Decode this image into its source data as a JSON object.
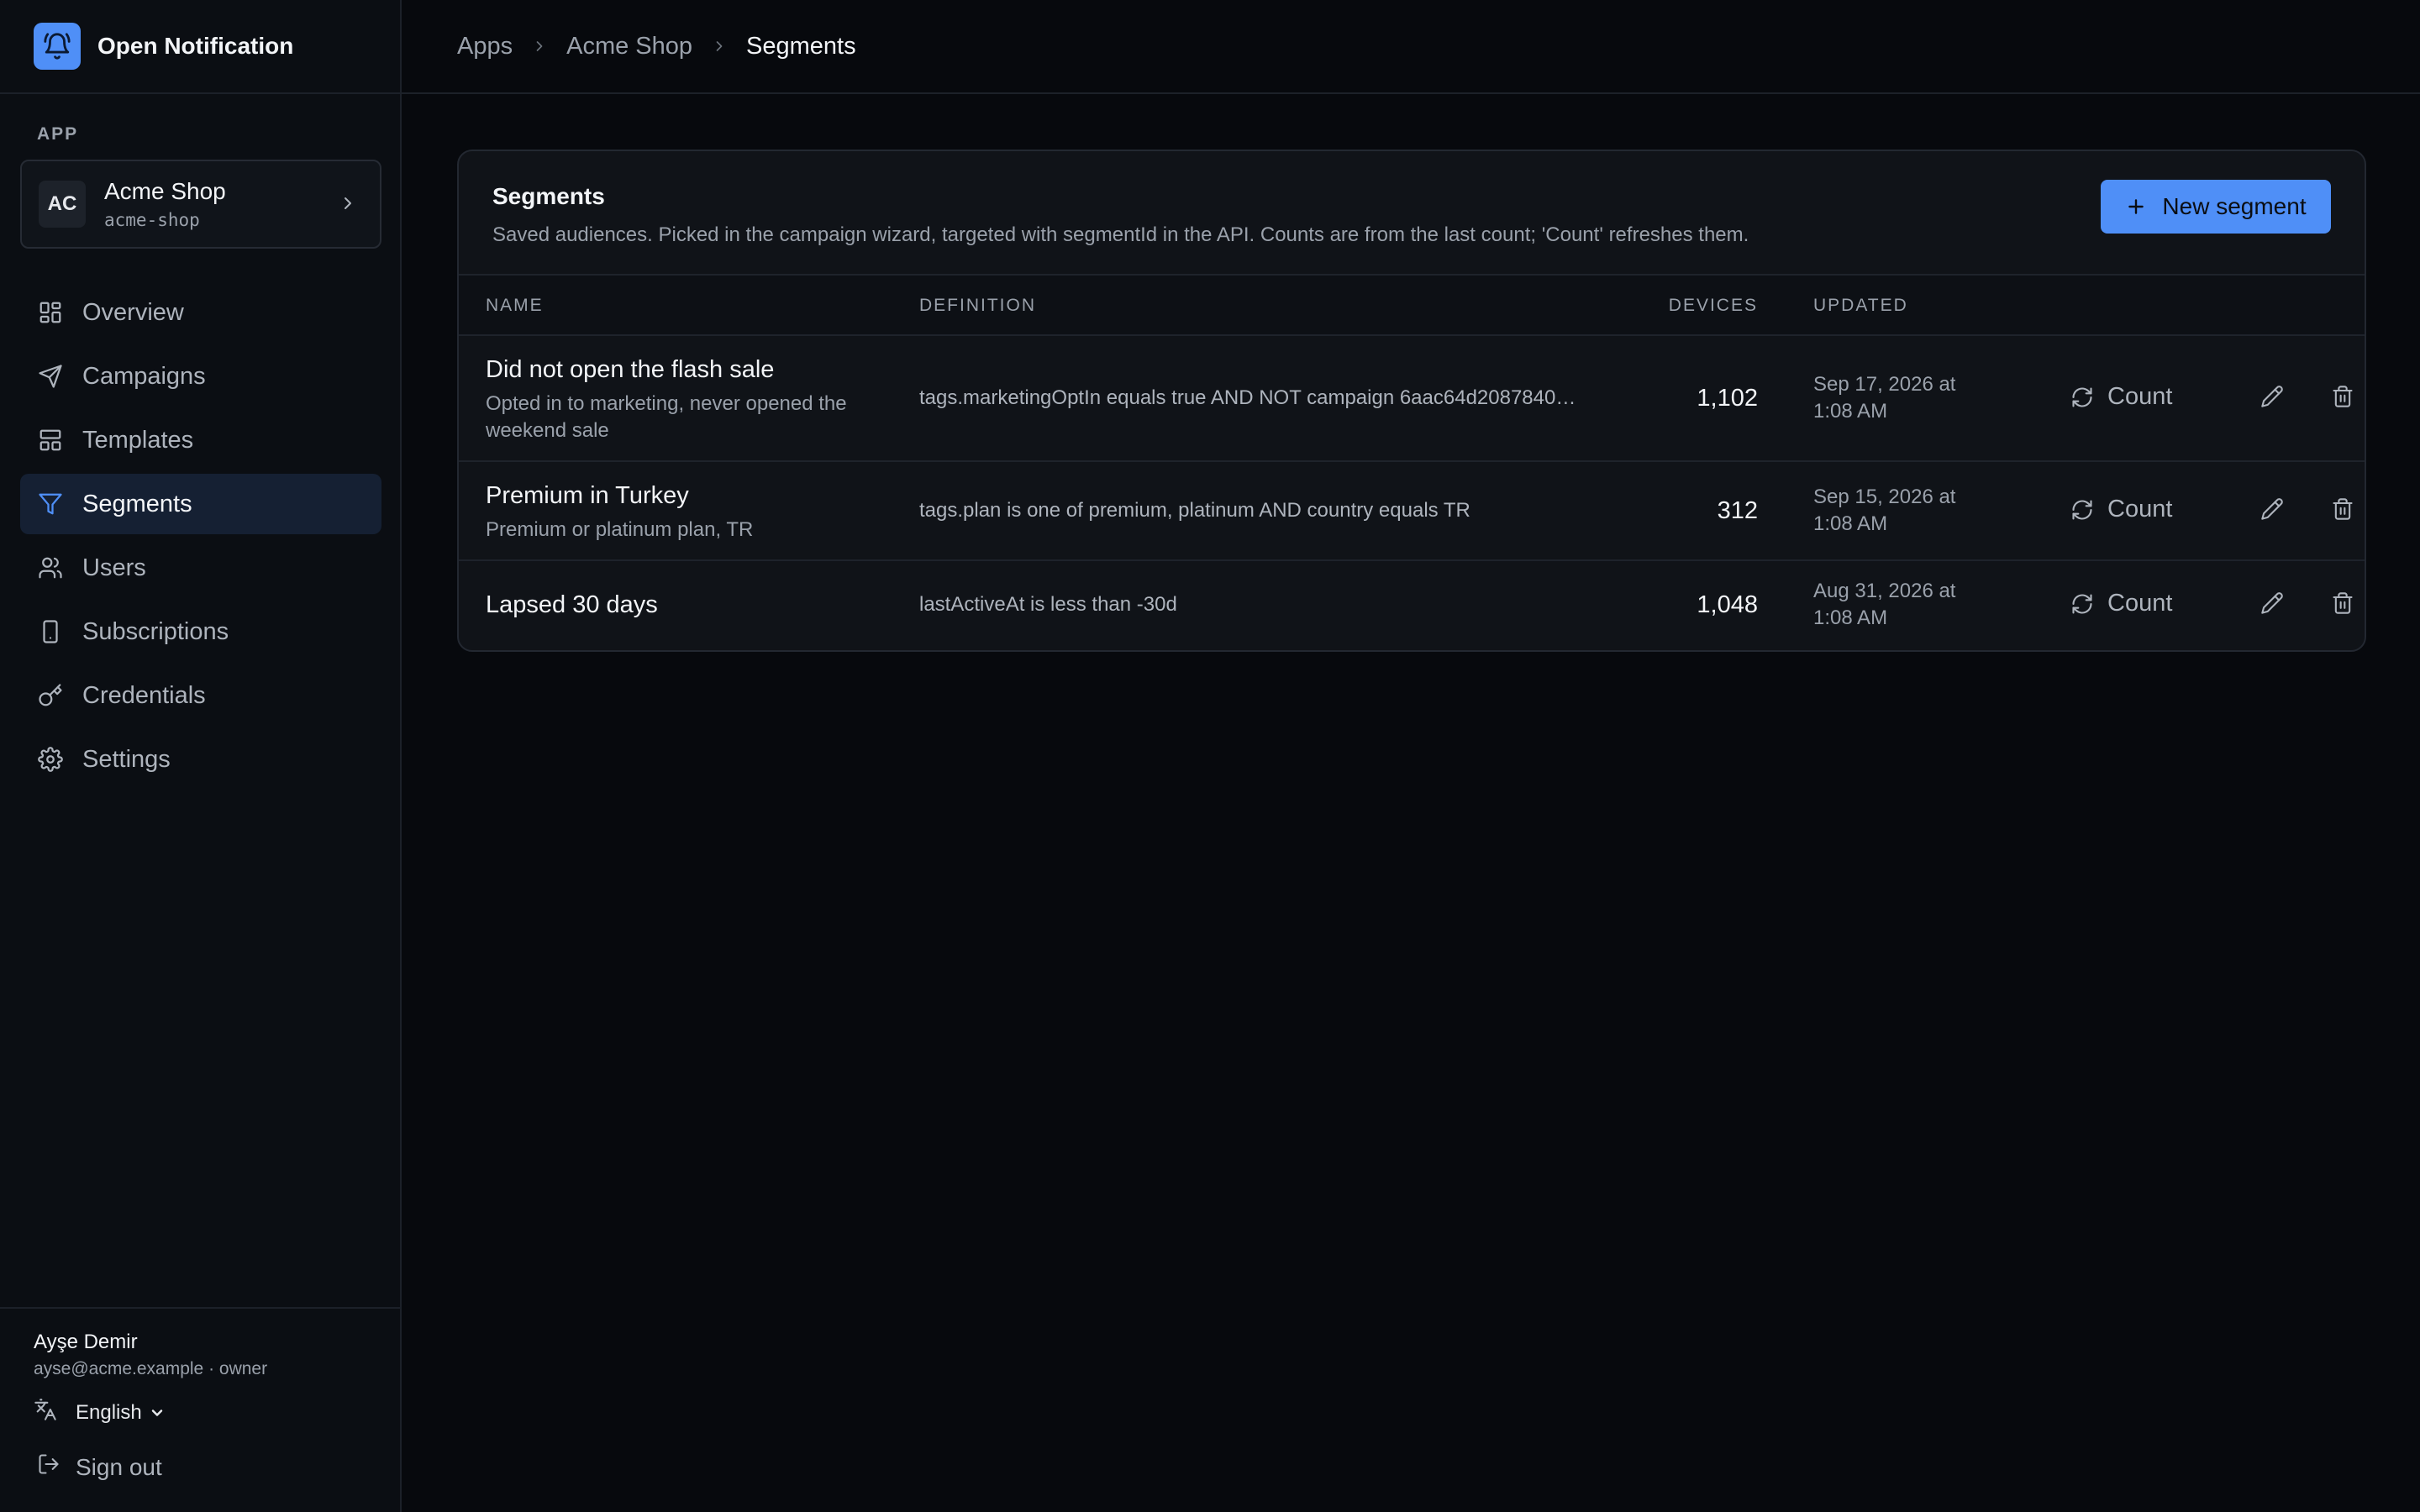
{
  "brand": {
    "name": "Open Notification",
    "icon": "bell-icon"
  },
  "sidebar": {
    "section_label": "APP",
    "app": {
      "initials": "AC",
      "name": "Acme Shop",
      "slug": "acme-shop"
    },
    "nav": [
      {
        "label": "Overview",
        "icon": "grid-icon",
        "active": false
      },
      {
        "label": "Campaigns",
        "icon": "send-icon",
        "active": false
      },
      {
        "label": "Templates",
        "icon": "layout-icon",
        "active": false
      },
      {
        "label": "Segments",
        "icon": "filter-icon",
        "active": true
      },
      {
        "label": "Users",
        "icon": "users-icon",
        "active": false
      },
      {
        "label": "Subscriptions",
        "icon": "smartphone-icon",
        "active": false
      },
      {
        "label": "Credentials",
        "icon": "key-icon",
        "active": false
      },
      {
        "label": "Settings",
        "icon": "gear-icon",
        "active": false
      }
    ],
    "footer": {
      "user_name": "Ayşe Demir",
      "user_meta": "ayse@acme.example · owner",
      "language": "English",
      "sign_out": "Sign out"
    }
  },
  "breadcrumb": [
    "Apps",
    "Acme Shop",
    "Segments"
  ],
  "card": {
    "title": "Segments",
    "description": "Saved audiences. Picked in the campaign wizard, targeted with segmentId in the API. Counts are from the last count; 'Count' refreshes them.",
    "new_button": "New segment"
  },
  "table": {
    "headers": {
      "name": "NAME",
      "definition": "DEFINITION",
      "devices": "DEVICES",
      "updated": "UPDATED"
    },
    "action_count_label": "Count",
    "rows": [
      {
        "name": "Did not open the flash sale",
        "description": "Opted in to marketing, never opened the weekend sale",
        "definition": "tags.marketingOptIn equals true AND NOT campaign 6aac64d2087840…",
        "devices": "1,102",
        "updated": "Sep 17, 2026 at 1:08 AM"
      },
      {
        "name": "Premium in Turkey",
        "description": "Premium or platinum plan, TR",
        "definition": "tags.plan is one of premium, platinum AND country equals TR",
        "devices": "312",
        "updated": "Sep 15, 2026 at 1:08 AM"
      },
      {
        "name": "Lapsed 30 days",
        "description": "",
        "definition": "lastActiveAt is less than -30d",
        "devices": "1,048",
        "updated": "Aug 31, 2026 at 1:08 AM"
      }
    ]
  },
  "colors": {
    "accent": "#4f8ff7",
    "background": "#07090d",
    "active_nav": "#152033"
  }
}
